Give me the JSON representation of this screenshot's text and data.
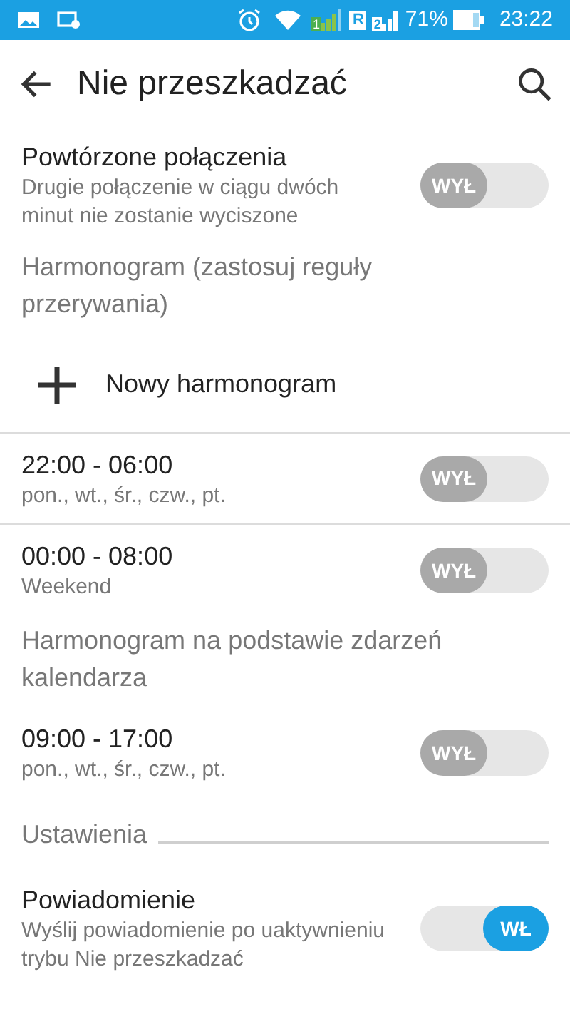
{
  "status_bar": {
    "sim_1": "1",
    "roaming": "R",
    "sim_2": "2",
    "battery": "71%",
    "time": "23:22"
  },
  "app_bar": {
    "title": "Nie przeszkadzać"
  },
  "items": [
    {
      "kind": "toggle",
      "title": "Powtórzone połączenia",
      "subtitle": "Drugie połączenie w ciągu dwóch minut nie zostanie wyciszone",
      "on": false,
      "toggle_label": "WYŁ",
      "divider": false
    },
    {
      "kind": "header",
      "title": "Harmonogram (zastosuj reguły przerywania)"
    },
    {
      "kind": "add",
      "title": "Nowy harmonogram",
      "divider": true
    },
    {
      "kind": "toggle",
      "title": "22:00 - 06:00",
      "subtitle": "pon., wt., śr., czw., pt.",
      "on": false,
      "toggle_label": "WYŁ",
      "divider": true
    },
    {
      "kind": "toggle",
      "title": "00:00 - 08:00",
      "subtitle": "Weekend",
      "on": false,
      "toggle_label": "WYŁ",
      "divider": false
    },
    {
      "kind": "header",
      "title": "Harmonogram na podstawie zdarzeń kalendarza"
    },
    {
      "kind": "toggle",
      "title": "09:00 - 17:00",
      "subtitle": "pon., wt., śr., czw., pt.",
      "on": false,
      "toggle_label": "WYŁ",
      "divider": false
    },
    {
      "kind": "category",
      "title": "Ustawienia"
    },
    {
      "kind": "toggle",
      "title": "Powiadomienie",
      "subtitle": "Wyślij powiadomienie po uaktywnieniu trybu Nie przeszkadzać",
      "on": true,
      "toggle_label": "WŁ",
      "divider": false
    }
  ]
}
